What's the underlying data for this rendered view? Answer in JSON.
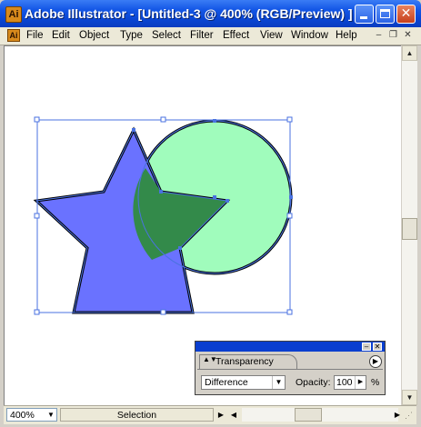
{
  "window": {
    "app_icon_letter": "Ai",
    "title": "Adobe Illustrator - [Untitled-3 @ 400% (RGB/Preview) ]",
    "minimize_glyph": "",
    "close_glyph": "✕"
  },
  "menubar": {
    "doc_icon_letter": "Ai",
    "items": [
      {
        "label": "File"
      },
      {
        "label": "Edit"
      },
      {
        "label": "Object"
      },
      {
        "label": "Type"
      },
      {
        "label": "Select"
      },
      {
        "label": "Filter"
      },
      {
        "label": "Effect"
      },
      {
        "label": "View"
      },
      {
        "label": "Window"
      },
      {
        "label": "Help"
      }
    ],
    "doc_minimize": "–",
    "doc_restore": "❐",
    "doc_close": "✕"
  },
  "artwork": {
    "circle_fill": "#a0fcbc",
    "star_fill": "#6a72ff",
    "overlap_fill": "#338a4a",
    "selection_color": "#4a72e0"
  },
  "statusbar": {
    "zoom": "400%",
    "zoom_arrow": "▼",
    "status": "Selection",
    "status_right_arrow": "▶",
    "status_left_arrow": "◀",
    "scroll_right_arrow": "▶"
  },
  "scrollbar": {
    "up_arrow": "▲",
    "down_arrow": "▼"
  },
  "transparency_panel": {
    "tab_label": "Transparency",
    "tab_arrows": "▲▼",
    "menu_arrow": "▶",
    "blend_mode": "Difference",
    "blend_arrow": "▼",
    "opacity_label": "Opacity:",
    "opacity_value": "100",
    "opacity_arrow": "▶",
    "opacity_unit": "%",
    "minimize_glyph": "–",
    "close_glyph": "✕"
  }
}
